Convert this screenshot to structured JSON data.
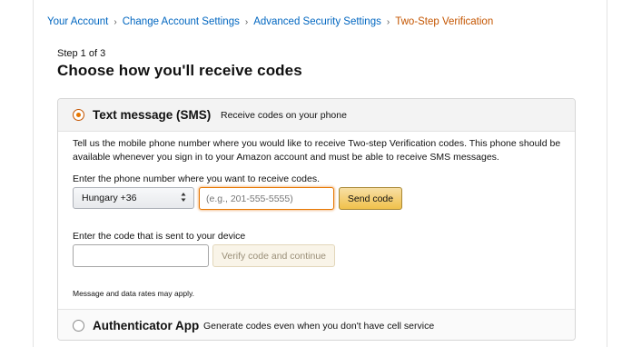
{
  "breadcrumb": {
    "items": [
      "Your Account",
      "Change Account Settings",
      "Advanced Security Settings",
      "Two-Step Verification"
    ],
    "separator": "›"
  },
  "step": "Step 1 of 3",
  "title": "Choose how you'll receive codes",
  "sms_option": {
    "title": "Text message (SMS)",
    "subtitle": "Receive codes on your phone",
    "selected": true,
    "description": "Tell us the mobile phone number where you would like to receive Two-step Verification codes. This phone should be available whenever you sign in to your Amazon account and must be able to receive SMS messages.",
    "phone_label": "Enter the phone number where you want to receive codes.",
    "country_value": "Hungary +36",
    "phone_placeholder": "(e.g., 201-555-5555)",
    "send_button": "Send code",
    "code_label": "Enter the code that is sent to your device",
    "code_value": "",
    "verify_button": "Verify code and continue",
    "note": "Message and data rates may apply."
  },
  "auth_option": {
    "title": "Authenticator App",
    "subtitle": "Generate codes even when you don't have cell service",
    "selected": false
  },
  "colors": {
    "link": "#0066c0",
    "active_crumb": "#c45500",
    "accent_orange": "#e77600",
    "button_yellow": "#f0c14b"
  },
  "icons": [
    "chevron-right-icon",
    "radio-selected-icon",
    "radio-unselected-icon",
    "select-arrows-icon"
  ]
}
